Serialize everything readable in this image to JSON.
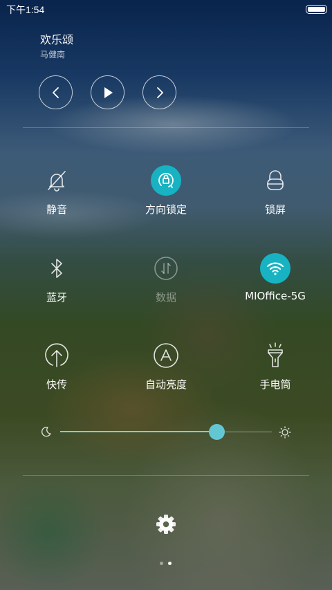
{
  "status_bar": {
    "time": "下午1:54",
    "battery_level": 1.0
  },
  "music": {
    "title": "欢乐颂",
    "artist": "马健南",
    "controls": {
      "previous": "previous-icon",
      "play": "play-icon",
      "next": "next-icon"
    }
  },
  "toggles": [
    {
      "label": "静音",
      "icon": "bell-off-icon",
      "state": "off"
    },
    {
      "label": "方向锁定",
      "icon": "rotation-lock-icon",
      "state": "on"
    },
    {
      "label": "锁屏",
      "icon": "lock-icon",
      "state": "off"
    },
    {
      "label": "蓝牙",
      "icon": "bluetooth-icon",
      "state": "off"
    },
    {
      "label": "数据",
      "icon": "mobile-data-icon",
      "state": "disabled"
    },
    {
      "label": "MIOffice-5G",
      "icon": "wifi-icon",
      "state": "on"
    },
    {
      "label": "快传",
      "icon": "share-icon",
      "state": "off"
    },
    {
      "label": "自动亮度",
      "icon": "auto-brightness-icon",
      "state": "off"
    },
    {
      "label": "手电筒",
      "icon": "flashlight-icon",
      "state": "off"
    }
  ],
  "brightness": {
    "level": 0.74,
    "min_icon": "moon-icon",
    "max_icon": "sun-icon"
  },
  "settings_icon": "gear-icon",
  "pager": {
    "pages": 2,
    "current": 2
  },
  "colors": {
    "accent": "#17b3c2",
    "slider": "#6fd4df"
  }
}
